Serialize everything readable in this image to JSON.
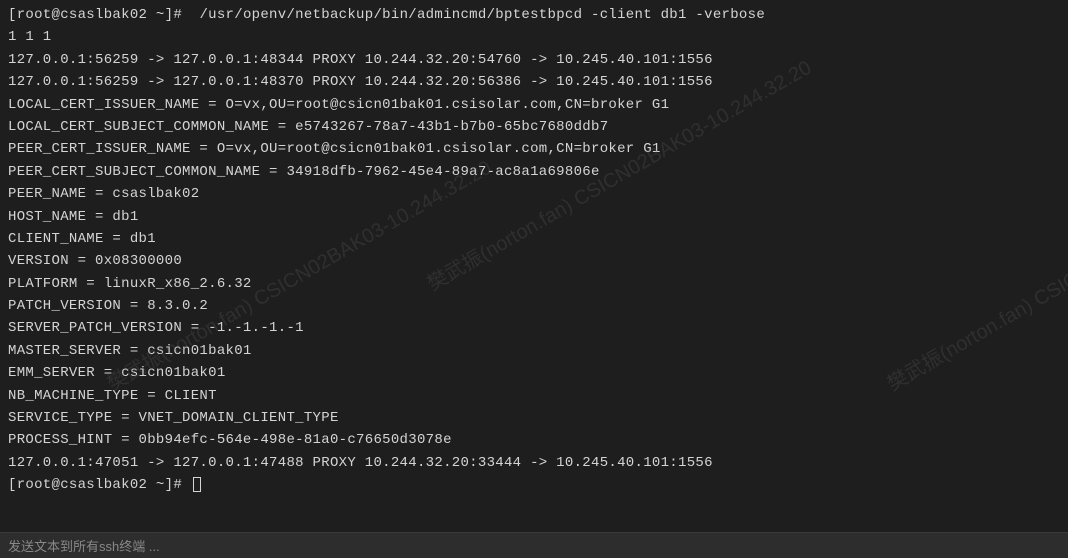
{
  "terminal": {
    "prompt1": "[root@csaslbak02 ~]#  ",
    "command": "/usr/openv/netbackup/bin/admincmd/bptestbpcd -client db1 -verbose",
    "lines": [
      "1 1 1",
      "127.0.0.1:56259 -> 127.0.0.1:48344 PROXY 10.244.32.20:54760 -> 10.245.40.101:1556",
      "127.0.0.1:56259 -> 127.0.0.1:48370 PROXY 10.244.32.20:56386 -> 10.245.40.101:1556",
      "LOCAL_CERT_ISSUER_NAME = O=vx,OU=root@csicn01bak01.csisolar.com,CN=broker G1",
      "LOCAL_CERT_SUBJECT_COMMON_NAME = e5743267-78a7-43b1-b7b0-65bc7680ddb7",
      "PEER_CERT_ISSUER_NAME = O=vx,OU=root@csicn01bak01.csisolar.com,CN=broker G1",
      "PEER_CERT_SUBJECT_COMMON_NAME = 34918dfb-7962-45e4-89a7-ac8a1a69806e",
      "PEER_NAME = csaslbak02",
      "HOST_NAME = db1",
      "CLIENT_NAME = db1",
      "VERSION = 0x08300000",
      "PLATFORM = linuxR_x86_2.6.32",
      "PATCH_VERSION = 8.3.0.2",
      "SERVER_PATCH_VERSION = -1.-1.-1.-1",
      "MASTER_SERVER = csicn01bak01",
      "EMM_SERVER = csicn01bak01",
      "NB_MACHINE_TYPE = CLIENT",
      "SERVICE_TYPE = VNET_DOMAIN_CLIENT_TYPE",
      "PROCESS_HINT = 0bb94efc-564e-498e-81a0-c76650d3078e",
      "127.0.0.1:47051 -> 127.0.0.1:47488 PROXY 10.244.32.20:33444 -> 10.245.40.101:1556"
    ],
    "prompt2": "[root@csaslbak02 ~]# "
  },
  "watermark": {
    "text": "樊武振(norton.fan)\nCSICN02BAK03-10.244.32.20"
  },
  "statusbar": {
    "text": "发送文本到所有ssh终端 ..."
  }
}
